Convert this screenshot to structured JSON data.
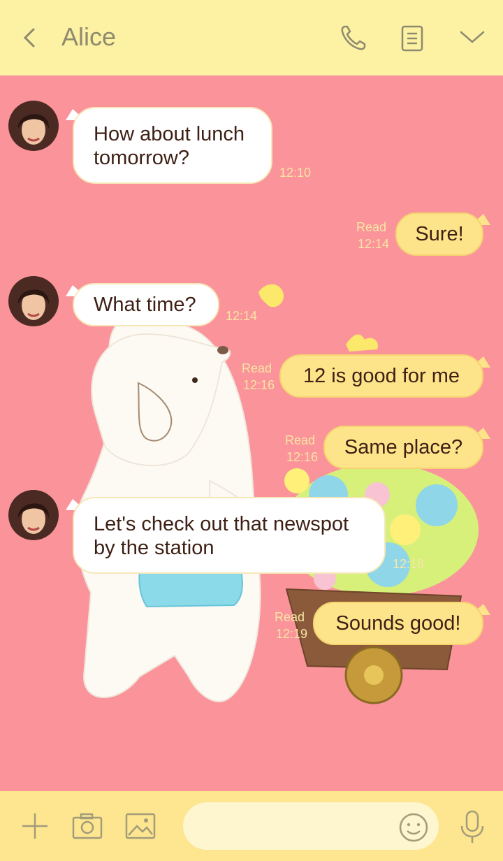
{
  "header": {
    "title": "Alice",
    "icons": [
      "back-arrow-icon",
      "phone-icon",
      "notes-icon",
      "chevron-down-icon"
    ]
  },
  "messages": [
    {
      "side": "in",
      "text": "How about lunch tomorrow?",
      "lines": [
        "How about lunch",
        "tomorrow?"
      ],
      "time": "12:10"
    },
    {
      "side": "out",
      "text": "Sure!",
      "read": "Read",
      "time": "12:14"
    },
    {
      "side": "in",
      "text": "What time?",
      "time": "12:14"
    },
    {
      "side": "out",
      "text": "12 is good for me",
      "read": "Read",
      "time": "12:16"
    },
    {
      "side": "out",
      "text": "Same place?",
      "read": "Read",
      "time": "12:16"
    },
    {
      "side": "in",
      "text": "Let's check out that newspot by the station",
      "lines": [
        "Let's check out that newspot",
        "by the station"
      ],
      "time": "12:18"
    },
    {
      "side": "out",
      "text": "Sounds good!",
      "read": "Read",
      "time": "12:19"
    }
  ],
  "footer": {
    "icons": [
      "plus-icon",
      "camera-icon",
      "image-icon",
      "emoji-icon",
      "microphone-icon"
    ],
    "input_value": ""
  },
  "colors": {
    "header_bg": "#fdf1a4",
    "chat_bg": "#fb939a",
    "out_bubble": "#fde48a",
    "in_bubble": "#ffffff",
    "footer_bg": "#fde68f"
  }
}
